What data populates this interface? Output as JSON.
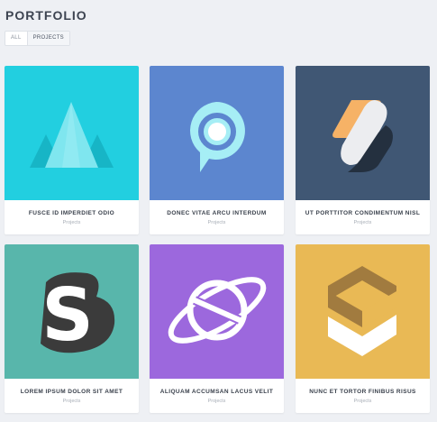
{
  "header": {
    "title": "PORTFOLIO"
  },
  "filters": {
    "items": [
      {
        "label": "ALL",
        "active": false
      },
      {
        "label": "PROJECTS",
        "active": true
      }
    ]
  },
  "cards": [
    {
      "title": "FUSCE ID IMPERDIET ODIO",
      "category": "Projects",
      "background": "#22cfe0",
      "icon": "mountain-icon"
    },
    {
      "title": "DONEC VITAE ARCU INTERDUM",
      "category": "Projects",
      "background": "#5c86cf",
      "icon": "location-pin-icon"
    },
    {
      "title": "UT PORTTITOR CONDIMENTUM NISL",
      "category": "Projects",
      "background": "#405774",
      "icon": "leaves-icon"
    },
    {
      "title": "LOREM IPSUM DOLOR SIT AMET",
      "category": "Projects",
      "background": "#58b6ab",
      "icon": "letter-s-icon"
    },
    {
      "title": "ALIQUAM ACCUMSAN LACUS VELIT",
      "category": "Projects",
      "background": "#9c68dd",
      "icon": "planet-icon"
    },
    {
      "title": "NUNC ET TORTOR FINIBUS RISUS",
      "category": "Projects",
      "background": "#e9b955",
      "icon": "box-check-icon"
    }
  ]
}
